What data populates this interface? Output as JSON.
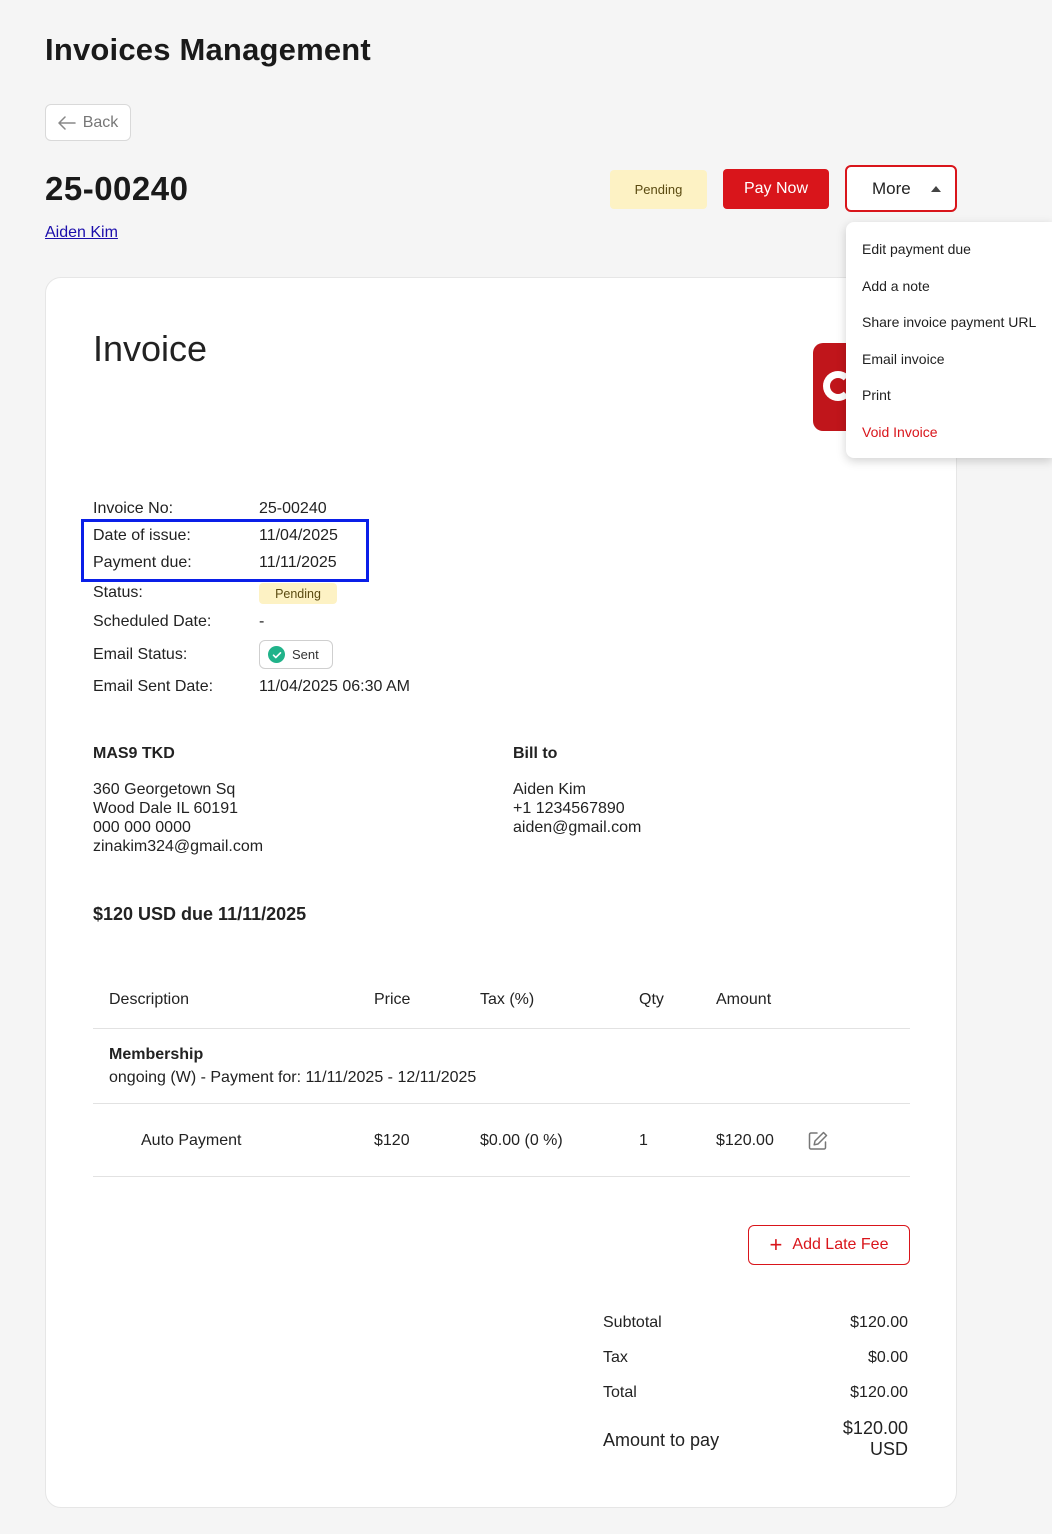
{
  "page": {
    "title": "Invoices Management"
  },
  "back": {
    "label": "Back"
  },
  "invoice": {
    "id": "25-00240",
    "client": "Aiden Kim",
    "status": "Pending",
    "heading": "Invoice"
  },
  "actions": {
    "pay_now": "Pay Now",
    "more": "More"
  },
  "menu": {
    "items": [
      {
        "label": "Edit payment due"
      },
      {
        "label": "Add a note"
      },
      {
        "label": "Share invoice payment URL"
      },
      {
        "label": "Email invoice"
      },
      {
        "label": "Print"
      },
      {
        "label": "Void Invoice"
      }
    ]
  },
  "meta": {
    "invoice_no_label": "Invoice No:",
    "invoice_no": "25-00240",
    "date_of_issue_label": "Date of issue:",
    "date_of_issue": "11/04/2025",
    "payment_due_label": "Payment due:",
    "payment_due": "11/11/2025",
    "status_label": "Status:",
    "status": "Pending",
    "scheduled_date_label": "Scheduled Date:",
    "scheduled_date": "-",
    "email_status_label": "Email Status:",
    "email_status": "Sent",
    "email_sent_date_label": "Email Sent Date:",
    "email_sent_date": "11/04/2025 06:30 AM"
  },
  "from": {
    "name": "MAS9 TKD",
    "lines": [
      "360 Georgetown Sq",
      "Wood Dale IL 60191",
      "000 000 0000",
      "zinakim324@gmail.com"
    ]
  },
  "bill_to": {
    "heading": "Bill to",
    "lines": [
      "Aiden Kim",
      "+1 1234567890",
      "aiden@gmail.com"
    ]
  },
  "due_summary": "$120 USD due 11/11/2025",
  "table": {
    "headers": [
      "Description",
      "Price",
      "Tax (%)",
      "Qty",
      "Amount"
    ],
    "group": {
      "title": "Membership",
      "subtitle": "ongoing (W) - Payment for: 11/11/2025 - 12/11/2025"
    },
    "rows": [
      {
        "description": "Auto Payment",
        "price": "$120",
        "tax": "$0.00 (0 %)",
        "qty": "1",
        "amount": "$120.00"
      }
    ]
  },
  "late_fee": {
    "label": "Add Late Fee"
  },
  "totals": {
    "subtotal_label": "Subtotal",
    "subtotal": "$120.00",
    "tax_label": "Tax",
    "tax": "$0.00",
    "total_label": "Total",
    "total": "$120.00",
    "amount_label": "Amount to pay",
    "amount_value": "$120.00",
    "amount_currency": "USD"
  },
  "colors": {
    "brand_red": "#d9151b",
    "pending_bg": "#fdf2c4",
    "highlight_blue": "#0a1fe8",
    "sent_green": "#21b38a"
  }
}
